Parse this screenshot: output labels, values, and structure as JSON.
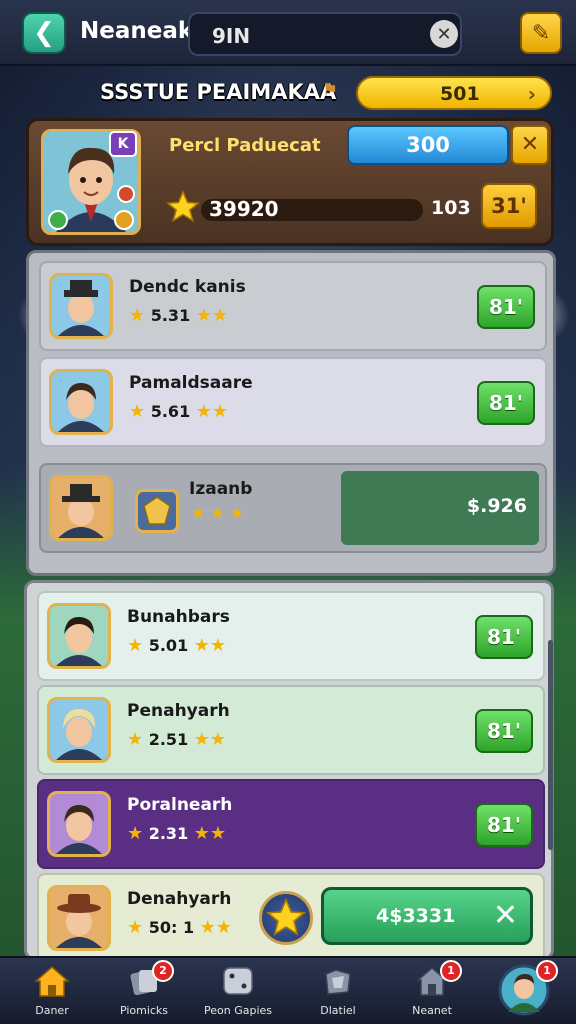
{
  "header": {
    "back_icon": "arrow-left-icon",
    "title": "Neaneak",
    "search_value": "9IN",
    "clear_icon": "close-icon",
    "settings_icon": "wrench-icon"
  },
  "status": {
    "title": "SSSTUE PEAIMAKAA",
    "coins": "501"
  },
  "profile": {
    "badge": "K",
    "name": "Percl Paduecat",
    "blue_value": "300",
    "close_label": "✕",
    "points": "39920",
    "level_value": "103",
    "level_button": "31'"
  },
  "list_a": [
    {
      "name": "Dendc kanis",
      "rating": "5.31",
      "button": "81'",
      "bg": "#c9ccd1"
    },
    {
      "name": "Pamaldsaare",
      "rating": "5.61",
      "button": "81'",
      "bg": "#dcdbe8"
    },
    {
      "name": "Izaanb",
      "rating": "",
      "price": "$.926",
      "bg": "#a9adb3"
    }
  ],
  "list_b": [
    {
      "name": "Bunahbars",
      "rating": "5.01",
      "button": "81'",
      "bg": "#e4f0ec"
    },
    {
      "name": "Penahyarh",
      "rating": "2.51",
      "button": "81'",
      "bg": "#d3ebd6"
    },
    {
      "name": "Poralnearh",
      "rating": "2.31",
      "button": "81'",
      "bg": "#5a2e82"
    },
    {
      "name": "Denahyarh",
      "rating": "50: 1",
      "sell_value": "4$3331",
      "bg": "#e6ecd4"
    }
  ],
  "nav": [
    {
      "label": "Daner",
      "icon": "home-icon",
      "badge": ""
    },
    {
      "label": "Piomicks",
      "icon": "cards-icon",
      "badge": "2"
    },
    {
      "label": "Peon Gapies",
      "icon": "dice-icon",
      "badge": ""
    },
    {
      "label": "Dlatiel",
      "icon": "puzzle-icon",
      "badge": ""
    },
    {
      "label": "Neanet",
      "icon": "house-icon",
      "badge": "1"
    },
    {
      "label": "",
      "icon": "profile-avatar-icon",
      "badge": "1"
    }
  ],
  "colors": {
    "accent_green": "#2ea42a",
    "accent_gold": "#f0b400",
    "accent_blue": "#2389d6",
    "row_purple": "#5a2e82"
  }
}
